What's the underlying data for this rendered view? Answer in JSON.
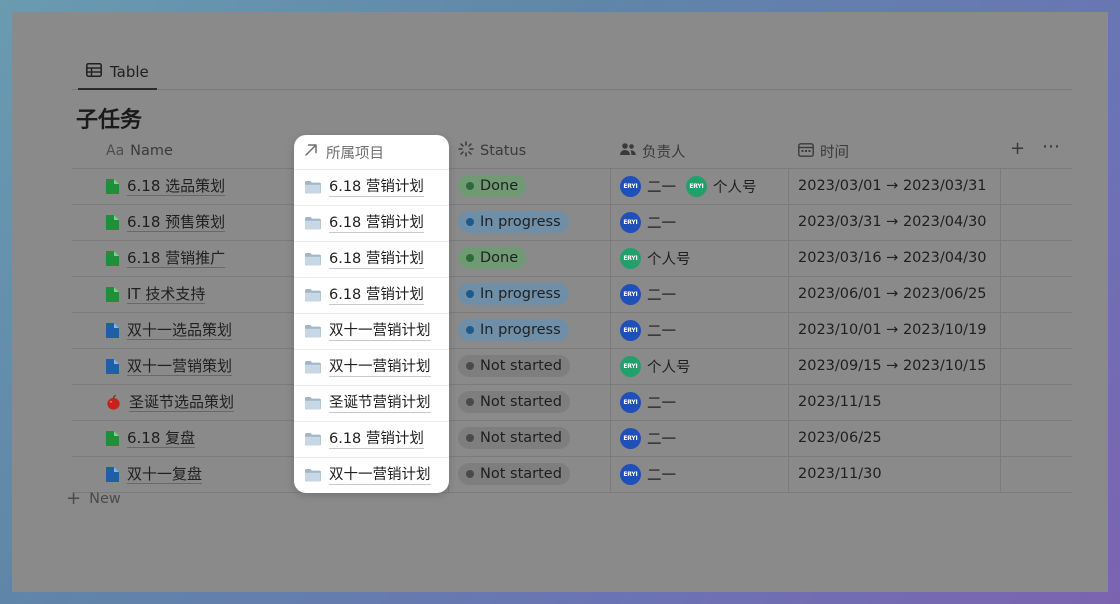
{
  "view_tab": {
    "label": "Table",
    "icon": "table-icon"
  },
  "database_title": "子任务",
  "columns": {
    "name": {
      "prefix": "Aa",
      "label": "Name"
    },
    "project": {
      "label": "所属项目"
    },
    "status": {
      "label": "Status"
    },
    "owner": {
      "label": "负责人"
    },
    "time": {
      "label": "时间"
    }
  },
  "rows": [
    {
      "name": "6.18 选品策划",
      "icon": "green-page-icon",
      "project": "6.18 营销计划",
      "status": "Done",
      "owners": [
        {
          "name": "二一",
          "avatar": "ERYI",
          "color": "#1f4fb8"
        },
        {
          "name": "个人号",
          "avatar": "ERYI",
          "color": "#22a06b"
        }
      ],
      "time": "2023/03/01 → 2023/03/31"
    },
    {
      "name": "6.18 预售策划",
      "icon": "green-page-icon",
      "project": "6.18 营销计划",
      "status": "In progress",
      "owners": [
        {
          "name": "二一",
          "avatar": "ERYI",
          "color": "#1f4fb8"
        }
      ],
      "time": "2023/03/31 → 2023/04/30"
    },
    {
      "name": "6.18 营销推广",
      "icon": "green-page-icon",
      "project": "6.18 营销计划",
      "status": "Done",
      "owners": [
        {
          "name": "个人号",
          "avatar": "ERYI",
          "color": "#22a06b"
        }
      ],
      "time": "2023/03/16 → 2023/04/30"
    },
    {
      "name": "IT 技术支持",
      "icon": "green-page-icon",
      "project": "6.18 营销计划",
      "status": "In progress",
      "owners": [
        {
          "name": "二一",
          "avatar": "ERYI",
          "color": "#1f4fb8"
        }
      ],
      "time": "2023/06/01 → 2023/06/25"
    },
    {
      "name": "双十一选品策划",
      "icon": "blue-page-icon",
      "project": "双十一营销计划",
      "status": "In progress",
      "owners": [
        {
          "name": "二一",
          "avatar": "ERYI",
          "color": "#1f4fb8"
        }
      ],
      "time": "2023/10/01 → 2023/10/19"
    },
    {
      "name": "双十一营销策划",
      "icon": "blue-page-icon",
      "project": "双十一营销计划",
      "status": "Not started",
      "owners": [
        {
          "name": "个人号",
          "avatar": "ERYI",
          "color": "#22a06b"
        }
      ],
      "time": "2023/09/15 → 2023/10/15"
    },
    {
      "name": "圣诞节选品策划",
      "icon": "apple-icon",
      "project": "圣诞节营销计划",
      "status": "Not started",
      "owners": [
        {
          "name": "二一",
          "avatar": "ERYI",
          "color": "#1f4fb8"
        }
      ],
      "time": "2023/11/15"
    },
    {
      "name": "6.18 复盘",
      "icon": "green-page-icon",
      "project": "6.18 营销计划",
      "status": "Not started",
      "owners": [
        {
          "name": "二一",
          "avatar": "ERYI",
          "color": "#1f4fb8"
        }
      ],
      "time": "2023/06/25"
    },
    {
      "name": "双十一复盘",
      "icon": "blue-page-icon",
      "project": "双十一营销计划",
      "status": "Not started",
      "owners": [
        {
          "name": "二一",
          "avatar": "ERYI",
          "color": "#1f4fb8"
        }
      ],
      "time": "2023/11/30"
    }
  ],
  "status_styles": {
    "Done": {
      "bg": "#6f9a74",
      "dot": "#2f6a3a"
    },
    "In progress": {
      "bg": "#6f8fa8",
      "dot": "#1f5a8a"
    },
    "Not started": {
      "bg": "#7e7e7e",
      "dot": "#4a4a4a"
    }
  },
  "new_label": "New",
  "add_column_icon": "plus-icon",
  "more_icon": "ellipsis-icon"
}
